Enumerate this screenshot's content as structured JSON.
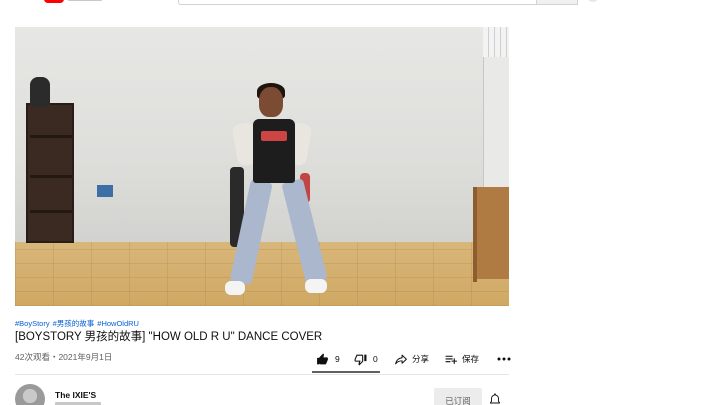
{
  "colors": {
    "link": "#065fd4",
    "text_primary": "#0f0f0f",
    "text_secondary": "#606060",
    "brand_red": "#ff0000",
    "subscribed_bg": "#ececec"
  },
  "video": {
    "hashtags": [
      "#BoyStory",
      "#男孩的故事",
      "#HowOldRU"
    ],
    "title": "[BOYSTORY 男孩的故事] \"HOW OLD R U\" DANCE COVER",
    "view_info": "42次观看・2021年9月1日"
  },
  "actions": {
    "like_icon": "thumbs-up-icon",
    "like_count": "9",
    "dislike_icon": "thumbs-down-icon",
    "dislike_count": "0",
    "share_icon": "share-arrow-icon",
    "share_label": "分享",
    "save_icon": "playlist-add-icon",
    "save_label": "保存",
    "more_icon": "more-horizontal-icon"
  },
  "channel": {
    "name": "The IXIE'S",
    "subscribed_label": "已订阅",
    "bell_icon": "bell-icon"
  }
}
